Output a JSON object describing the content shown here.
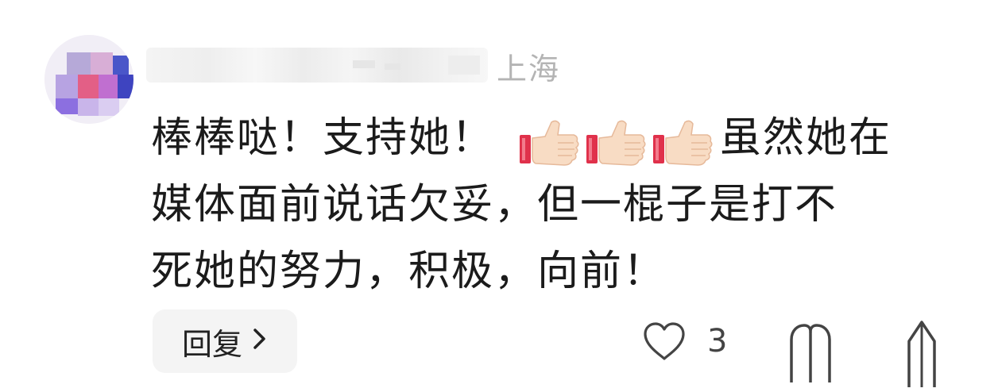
{
  "author": {
    "location": "上海"
  },
  "comment": {
    "line1_prefix": "棒棒哒！支持她！",
    "line1_suffix": "虽然她在",
    "line2": "媒体面前说话欠妥，但一棍子是打不",
    "line3": "死她的努力，积极，向前！",
    "emojis": [
      "thumbs-up-icon",
      "thumbs-up-icon",
      "thumbs-up-icon"
    ]
  },
  "actions": {
    "reply_label": "回复",
    "like_count": "3"
  },
  "colors": {
    "location": "#b4b4b4",
    "text": "#1b1b1b",
    "reply_bg": "#f4f4f4"
  }
}
